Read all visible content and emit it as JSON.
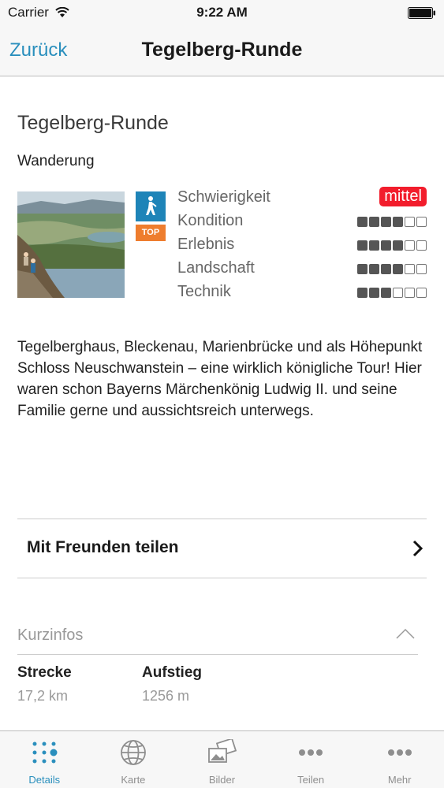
{
  "status_bar": {
    "carrier": "Carrier",
    "time": "9:22 AM"
  },
  "nav": {
    "back_label": "Zurück",
    "title": "Tegelberg-Runde"
  },
  "tour": {
    "title": "Tegelberg-Runde",
    "type": "Wanderung",
    "top_badge": "TOP",
    "description": "Tegelberghaus, Bleckenau, Marienbrücke und als Höhepunkt Schloss Neuschwanstein – eine wirklich königliche Tour!  Hier waren schon Bayerns Märchenkönig Ludwig II. und seine Familie gerne und aussichtsreich unterwegs."
  },
  "ratings": [
    {
      "label": "Schwierigkeit",
      "value": "mittel",
      "color": "#f21d2c"
    },
    {
      "label": "Kondition",
      "score": 4,
      "max": 6
    },
    {
      "label": "Erlebnis",
      "score": 4,
      "max": 6
    },
    {
      "label": "Landschaft",
      "score": 4,
      "max": 6
    },
    {
      "label": "Technik",
      "score": 3,
      "max": 6
    }
  ],
  "share": {
    "label": "Mit Freunden teilen"
  },
  "kurzinfos": {
    "label": "Kurzinfos",
    "stats": [
      {
        "label": "Strecke",
        "value": "17,2 km"
      },
      {
        "label": "Aufstieg",
        "value": "1256 m"
      }
    ]
  },
  "tabs": [
    {
      "label": "Details",
      "icon": "dots-grid-icon",
      "active": true
    },
    {
      "label": "Karte",
      "icon": "globe-icon",
      "active": false
    },
    {
      "label": "Bilder",
      "icon": "photos-icon",
      "active": false
    },
    {
      "label": "Teilen",
      "icon": "share-dots-icon",
      "active": false
    },
    {
      "label": "Mehr",
      "icon": "more-dots-icon",
      "active": false
    }
  ],
  "colors": {
    "accent": "#2a8fbd",
    "hike_badge": "#1e84b8",
    "top_badge": "#ee7d2e"
  }
}
